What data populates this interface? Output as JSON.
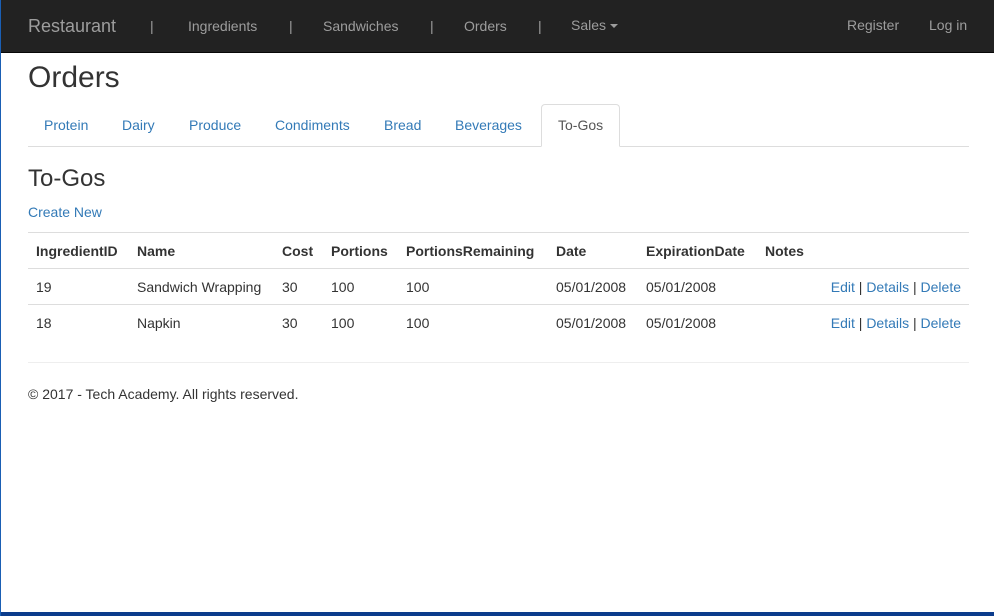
{
  "navbar": {
    "brand": "Restaurant",
    "separator": "|",
    "items": [
      {
        "label": "Ingredients"
      },
      {
        "label": "Sandwiches"
      },
      {
        "label": "Orders"
      },
      {
        "label": "Sales"
      }
    ],
    "right": [
      {
        "label": "Register"
      },
      {
        "label": "Log in"
      }
    ]
  },
  "page": {
    "title": "Orders",
    "tabs": [
      {
        "label": "Protein"
      },
      {
        "label": "Dairy"
      },
      {
        "label": "Produce"
      },
      {
        "label": "Condiments"
      },
      {
        "label": "Bread"
      },
      {
        "label": "Beverages"
      },
      {
        "label": "To-Gos",
        "active": true
      }
    ],
    "section_title": "To-Gos",
    "create_label": "Create New"
  },
  "table": {
    "columns": [
      "IngredientID",
      "Name",
      "Cost",
      "Portions",
      "PortionsRemaining",
      "Date",
      "ExpirationDate",
      "Notes"
    ],
    "rows": [
      {
        "id": "19",
        "name": "Sandwich Wrapping",
        "cost": "30",
        "portions": "100",
        "remaining": "100",
        "date": "05/01/2008",
        "expiration": "05/01/2008",
        "notes": ""
      },
      {
        "id": "18",
        "name": "Napkin",
        "cost": "30",
        "portions": "100",
        "remaining": "100",
        "date": "05/01/2008",
        "expiration": "05/01/2008",
        "notes": ""
      }
    ],
    "actions": {
      "edit": "Edit",
      "details": "Details",
      "delete": "Delete",
      "separator": "|"
    }
  },
  "footer": {
    "text": "© 2017 - Tech Academy. All rights reserved."
  }
}
